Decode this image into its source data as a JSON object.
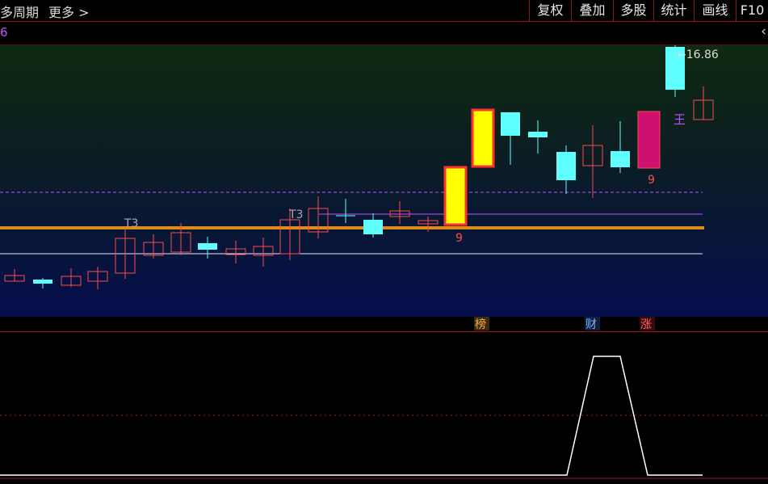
{
  "toolbar": {
    "left_items": [
      "多周期",
      "更多 >"
    ],
    "buttons": [
      "复权",
      "叠加",
      "多股",
      "统计",
      "画线",
      "F10"
    ]
  },
  "subbar": {
    "indicator_value": "6",
    "collapse_icon": "chevron-left-icon"
  },
  "chart": {
    "max_price_label": "16.86",
    "annotations": {
      "t3_a": "T3",
      "t3_b": "T3",
      "nine_a": "9",
      "nine_b": "9",
      "wang": "王"
    },
    "event_badges": [
      "榜",
      "财",
      "涨"
    ]
  },
  "colors": {
    "up_candle": "#ff4a4a",
    "down_candle": "#5fffff",
    "highlight_fill": "#ffff00",
    "limit_up_fill": "#d01070",
    "thick_line": "#e08a1a",
    "purple_line": "#c050ff",
    "white_line": "#e8e8ff"
  }
}
